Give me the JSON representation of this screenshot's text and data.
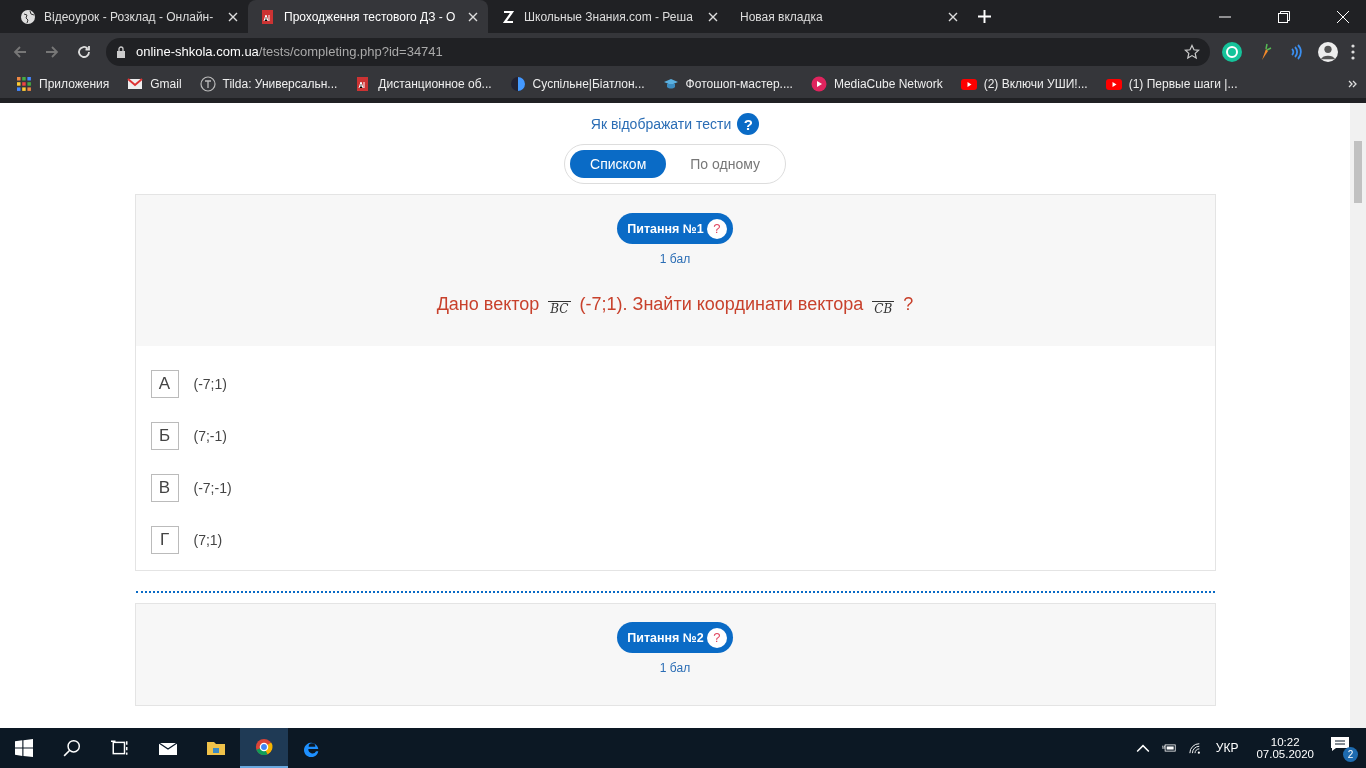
{
  "browser": {
    "tabs": [
      {
        "title": "Відеоурок - Розклад - Онлайн-",
        "selected": false
      },
      {
        "title": "Проходження тестового ДЗ - О",
        "selected": true
      },
      {
        "title": "Школьные Знания.com - Реша",
        "selected": false
      },
      {
        "title": "Новая вкладка",
        "selected": false
      }
    ],
    "url_host": "online-shkola.com.ua",
    "url_path": "/tests/completing.php?id=34741",
    "bookmarks": [
      "Приложения",
      "Gmail",
      "Tilda: Универсальн...",
      "Дистанционное об...",
      "Суспільне|Біатлон...",
      "Фотошоп-мастер....",
      "MediaCube Network",
      "(2) Включи УШИ!...",
      "(1) Первые шаги |..."
    ]
  },
  "page": {
    "display_label": "Як відображати тести",
    "display_help": "?",
    "modes": [
      {
        "label": "Списком",
        "selected": true
      },
      {
        "label": "По одному",
        "selected": false
      }
    ],
    "questions": [
      {
        "badge": "Питання №1",
        "help": "?",
        "points": "1 бал",
        "text": [
          {
            "kind": "text",
            "t": "Дано вектор "
          },
          {
            "kind": "vector",
            "t": "BC"
          },
          {
            "kind": "text",
            "t": " (-7;1). Знайти координати вектора "
          },
          {
            "kind": "vector",
            "t": "CB"
          },
          {
            "kind": "text",
            "t": " ?"
          }
        ],
        "answers": [
          {
            "letter": "А",
            "text": "(-7;1)"
          },
          {
            "letter": "Б",
            "text": "(7;-1)"
          },
          {
            "letter": "В",
            "text": "(-7;-1)"
          },
          {
            "letter": "Г",
            "text": "(7;1)"
          }
        ]
      },
      {
        "badge": "Питання №2",
        "help": "?",
        "points": "1 бал"
      }
    ]
  },
  "taskbar": {
    "language": "УКР",
    "time": "10:22",
    "date": "07.05.2020",
    "notifications": "2"
  }
}
